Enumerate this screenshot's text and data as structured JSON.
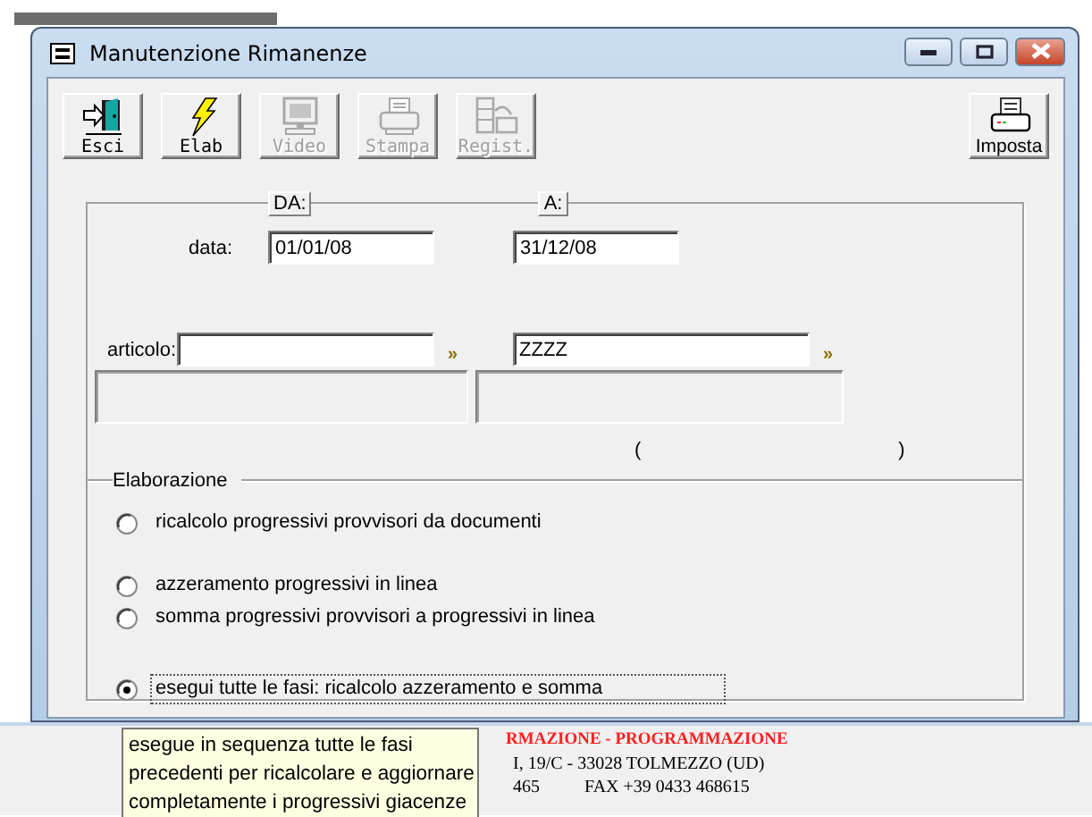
{
  "window": {
    "title": "Manutenzione Rimanenze"
  },
  "toolbar": [
    {
      "label": "Esci",
      "kind": "exit",
      "disabled": false
    },
    {
      "label": "Elab",
      "kind": "bolt",
      "disabled": false
    },
    {
      "label": "Video",
      "kind": "monitor",
      "disabled": true
    },
    {
      "label": "Stampa",
      "kind": "printer",
      "disabled": true
    },
    {
      "label": "Regist.",
      "kind": "cabinet",
      "disabled": true
    },
    {
      "label": "Imposta",
      "kind": "setup",
      "disabled": false
    }
  ],
  "range_headers": [
    "DA:",
    "A:"
  ],
  "date": {
    "label": "data:",
    "from": "01/01/08",
    "to": "31/12/08"
  },
  "article": {
    "label": "articolo:",
    "to": "ZZZZ",
    "lookup_buttons": [
      "»",
      "»"
    ]
  },
  "range_brackets": [
    "(",
    ")"
  ],
  "processing": {
    "title": "Elaborazione",
    "options": [
      {
        "label": "ricalcolo progressivi provvisori da documenti",
        "selected": false,
        "focused": false
      },
      {
        "label": "azzeramento progressivi in linea",
        "selected": false,
        "focused": false
      },
      {
        "label": "somma progressivi provvisori a progressivi in linea",
        "selected": false,
        "focused": false
      },
      {
        "label": "esegui tutte le fasi: ricalcolo azzeramento e somma",
        "selected": true,
        "focused": true
      }
    ]
  },
  "footer": [
    {
      "kind": "highlight",
      "texts": [
        "RMAZIONE - PROGRAMMAZIONE"
      ]
    },
    {
      "kind": "plain",
      "texts": [
        "I, 19/C - 33028 TOLMEZZO (UD)"
      ]
    },
    {
      "kind": "plain",
      "texts": [
        "465",
        "FAX  +39 0433 468615"
      ]
    }
  ],
  "tooltip": {
    "lines": [
      "esegue in sequenza tutte le fasi",
      "precedenti per ricalcolare e aggiornare",
      "completamente i progressivi giacenze"
    ]
  }
}
